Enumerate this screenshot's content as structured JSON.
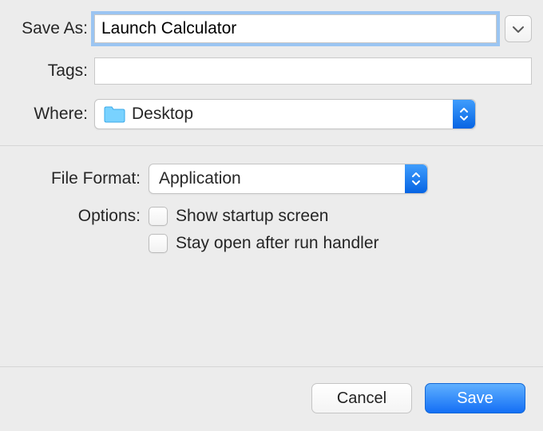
{
  "labels": {
    "save_as": "Save As:",
    "tags": "Tags:",
    "where": "Where:",
    "file_format": "File Format:",
    "options": "Options:"
  },
  "save_as": {
    "value": "Launch Calculator"
  },
  "tags": {
    "value": ""
  },
  "where": {
    "selected": "Desktop"
  },
  "file_format": {
    "selected": "Application"
  },
  "options": {
    "show_startup": {
      "label": "Show startup screen",
      "checked": false
    },
    "stay_open": {
      "label": "Stay open after run handler",
      "checked": false
    }
  },
  "buttons": {
    "cancel": "Cancel",
    "save": "Save"
  },
  "colors": {
    "accent": "#1b7cf5",
    "focus_ring": "#9bc5f2"
  }
}
